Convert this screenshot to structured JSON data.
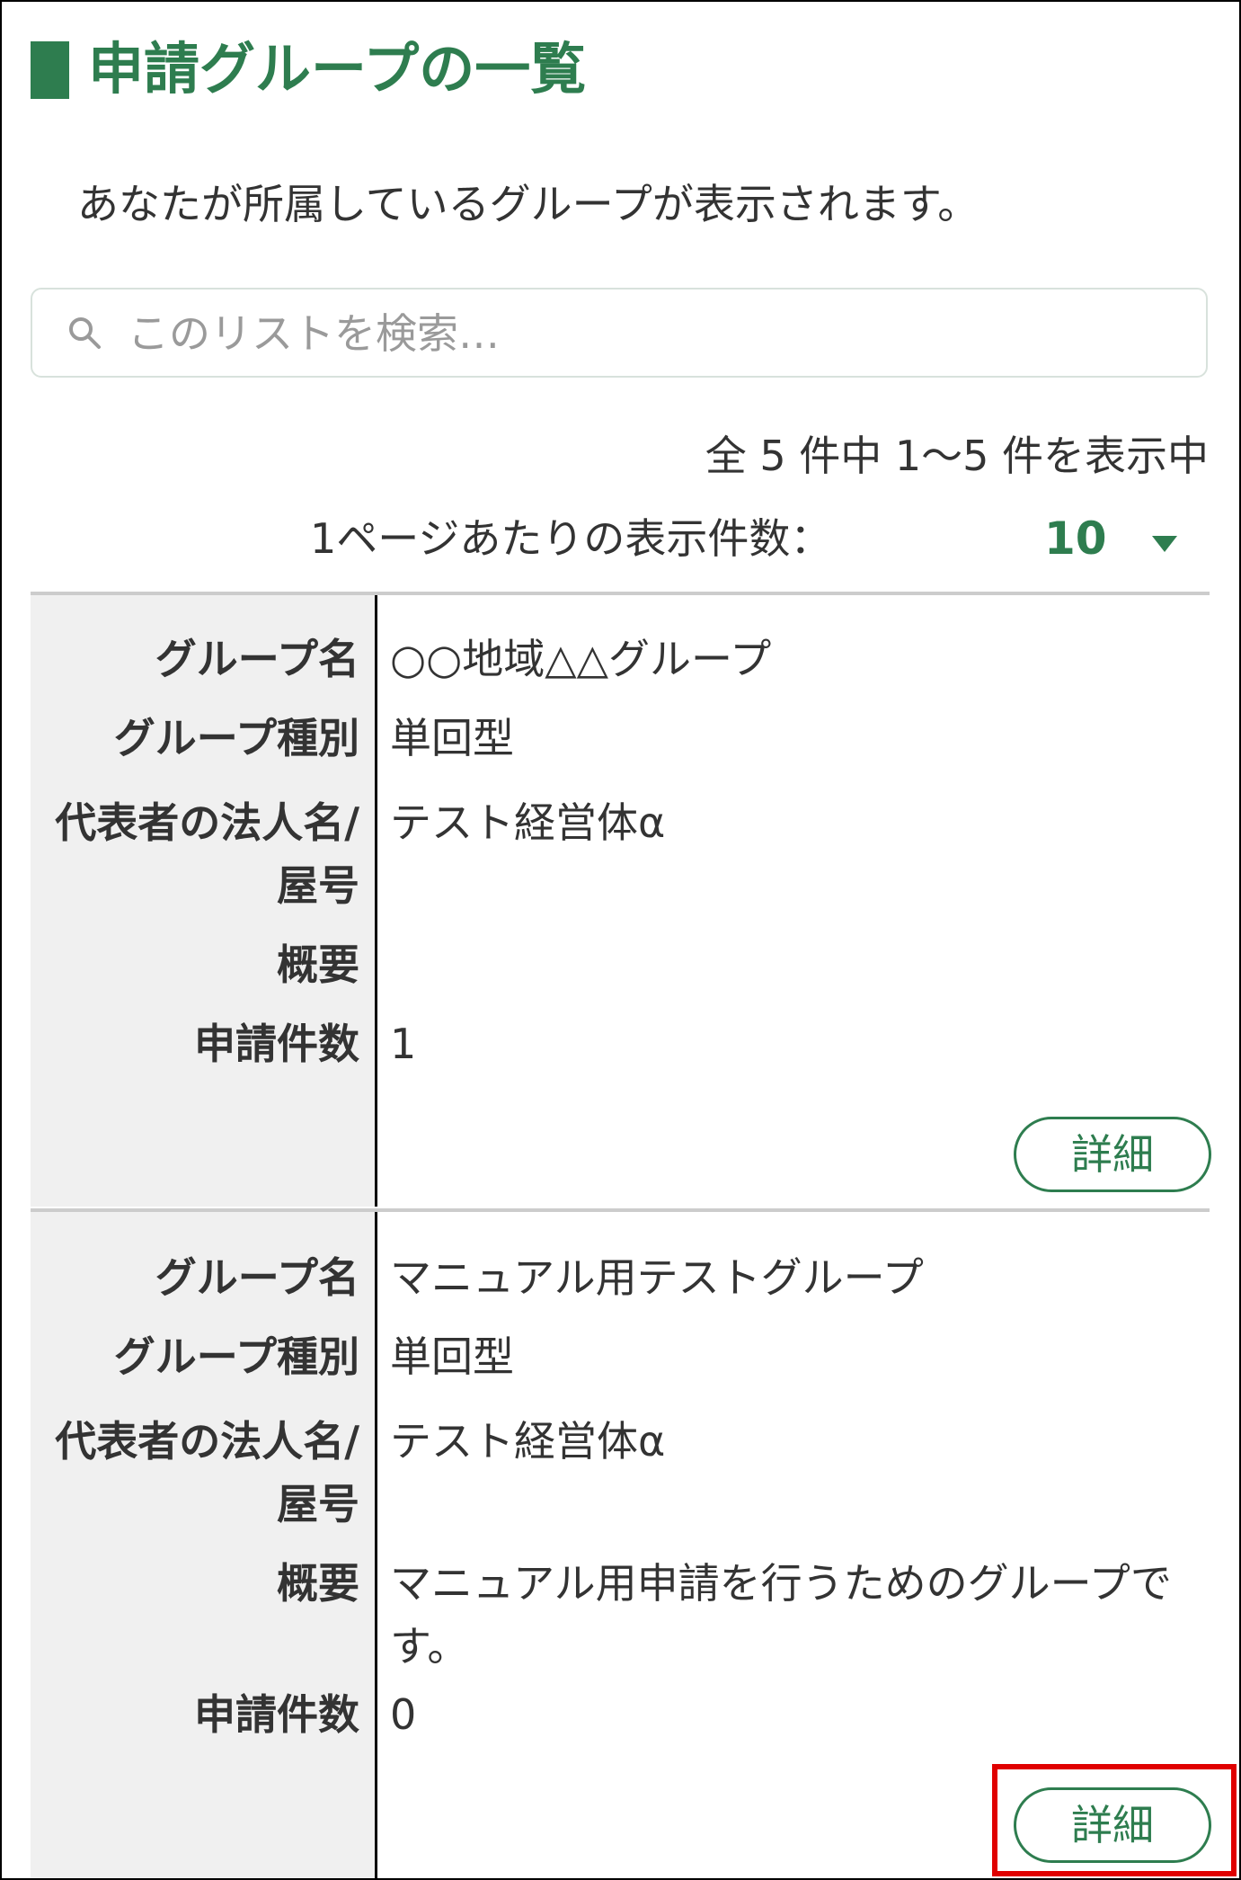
{
  "page": {
    "title": "申請グループの一覧",
    "description": "あなたが所属しているグループが表示されます。"
  },
  "search": {
    "placeholder": "このリストを検索…",
    "icon": "search-icon"
  },
  "pagination": {
    "summary": "全 5 件中 1～5 件を表示中",
    "per_page_label": "1ページあたりの表示件数：",
    "per_page_value": "10"
  },
  "labels": {
    "group_name": "グループ名",
    "group_type": "グループ種別",
    "representative": "代表者の法人名/屋号",
    "overview": "概要",
    "application_count": "申請件数"
  },
  "records": [
    {
      "group_name": "○○地域△△グループ",
      "group_type": "単回型",
      "representative": "テスト経営体α",
      "overview": "",
      "application_count": "1",
      "detail_label": "詳細"
    },
    {
      "group_name": "マニュアル用テストグループ",
      "group_type": "単回型",
      "representative": "テスト経営体α",
      "overview": "マニュアル用申請を行うためのグループです。",
      "application_count": "0",
      "detail_label": "詳細"
    }
  ],
  "colors": {
    "accent": "#2e7d4f",
    "highlight": "#e00000",
    "label_bg": "#f0f0f0"
  }
}
